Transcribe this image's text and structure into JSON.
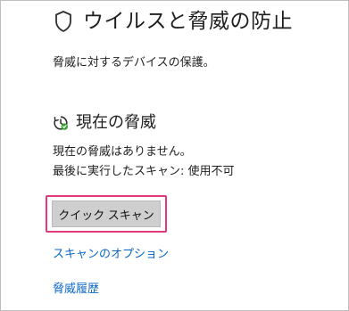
{
  "header": {
    "icon": "shield-icon",
    "title": "ウイルスと脅威の防止"
  },
  "subtitle": "脅威に対するデバイスの保護。",
  "current_threats": {
    "icon": "threat-scan-clock-icon",
    "title": "現在の脅威",
    "status_text": "現在の脅威はありません。",
    "last_scan_text": "最後に実行したスキャン: 使用不可"
  },
  "actions": {
    "quick_scan_label": "クイック スキャン",
    "scan_options_label": "スキャンのオプション",
    "threat_history_label": "脅威履歴"
  },
  "colors": {
    "link": "#0a67c8",
    "highlight_border": "#e03a7a",
    "button_bg": "#cfcfcf",
    "status_check": "#3aa335"
  }
}
